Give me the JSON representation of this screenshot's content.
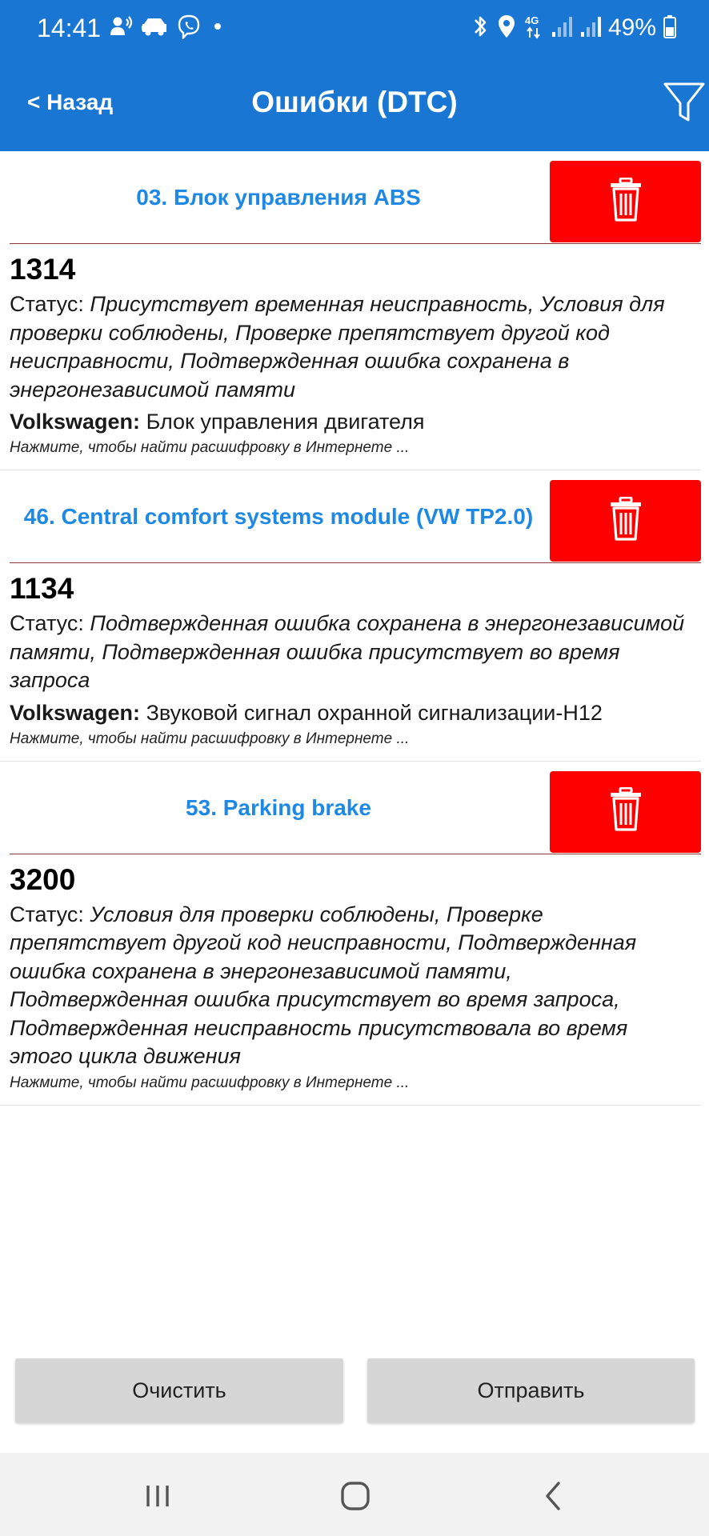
{
  "status_bar": {
    "time": "14:41",
    "left_icons": [
      "call-notification-icon",
      "car-icon",
      "viber-icon",
      "dot-icon"
    ],
    "right_icons": [
      "bluetooth-icon",
      "location-icon",
      "4g-icon",
      "signal-icon",
      "signal-icon",
      "battery-icon"
    ],
    "network": "4G",
    "battery": "49%"
  },
  "header": {
    "back_label": "< Назад",
    "title": "Ошибки (DTC)",
    "filter_icon": "filter-icon",
    "color": "#1976d2"
  },
  "modules": [
    {
      "title": "03. Блок управления ABS",
      "faults": [
        {
          "code": "1314",
          "status_label": "Статус:",
          "status_value": "Присутствует временная неисправность, Условия для проверки соблюдены, Проверке препятствует другой код неисправности, Подтвержденная ошибка сохранена в энергонезависимой памяти",
          "brand": "Volkswagen:",
          "description": "Блок управления двигателя",
          "hint": "Нажмите, чтобы найти расшифровку в Интернете ..."
        }
      ]
    },
    {
      "title": "46. Central comfort systems module (VW TP2.0)",
      "faults": [
        {
          "code": "1134",
          "status_label": "Статус:",
          "status_value": "Подтвержденная ошибка сохранена в энергонезависимой памяти, Подтвержденная ошибка присутствует во время запроса",
          "brand": "Volkswagen:",
          "description": "Звуковой сигнал охранной сигнализации-H12",
          "hint": "Нажмите, чтобы найти расшифровку в Интернете ..."
        }
      ]
    },
    {
      "title": "53. Parking brake",
      "faults": [
        {
          "code": "3200",
          "status_label": "Статус:",
          "status_value": "Условия для проверки соблюдены, Проверке препятствует другой код неисправности, Подтвержденная ошибка сохранена в энергонезависимой памяти, Подтвержденная ошибка присутствует во время запроса, Подтвержденная неисправность присутствовала во время этого цикла движения",
          "hint": "Нажмите, чтобы найти расшифровку в Интернете ..."
        }
      ]
    }
  ],
  "delete_icon": "trash-icon",
  "colors": {
    "module_title": "#1e88e5",
    "delete_button": "#ff0000",
    "bottom_button": "#d6d6d6"
  },
  "buttons": {
    "clear": "Очистить",
    "send": "Отправить"
  },
  "nav_bar": {
    "recents_icon": "recents-icon",
    "home_icon": "home-icon",
    "back_icon": "back-icon"
  }
}
